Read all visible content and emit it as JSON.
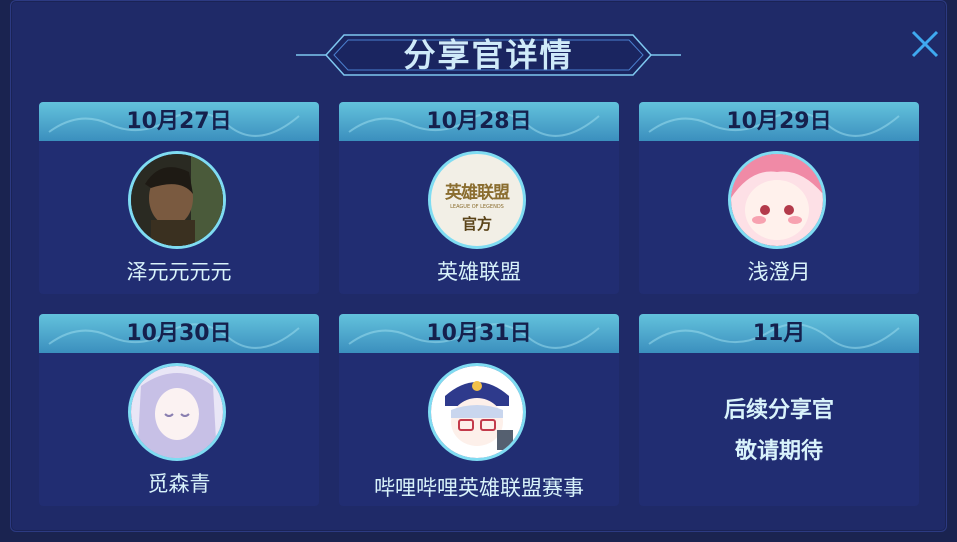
{
  "modal": {
    "title": "分享官详情",
    "close_icon": "close-icon"
  },
  "cards": [
    {
      "date": "10月27日",
      "name": "泽元元元元",
      "avatar": "man-photo-avatar"
    },
    {
      "date": "10月28日",
      "name": "英雄联盟",
      "avatar": "league-of-legends-logo-avatar",
      "logo_text": "英雄联盟",
      "logo_sub": "LEAGUE OF LEGENDS",
      "logo_badge": "官方"
    },
    {
      "date": "10月29日",
      "name": "浅澄月",
      "avatar": "anime-pink-hair-avatar"
    },
    {
      "date": "10月30日",
      "name": "觅森青",
      "avatar": "anime-silver-hair-avatar"
    },
    {
      "date": "10月31日",
      "name": "哔哩哔哩英雄联盟赛事",
      "avatar": "anime-chibi-avatar"
    },
    {
      "date": "11月",
      "line1": "后续分享官",
      "line2": "敬请期待"
    }
  ],
  "colors": {
    "background": "#1a2350",
    "panel": "#1f2a68",
    "card": "#212d72",
    "header_top": "#63c2dc",
    "header_bottom": "#3b8fbe",
    "text": "#d9f3fb",
    "accent": "#7fdcf2"
  }
}
